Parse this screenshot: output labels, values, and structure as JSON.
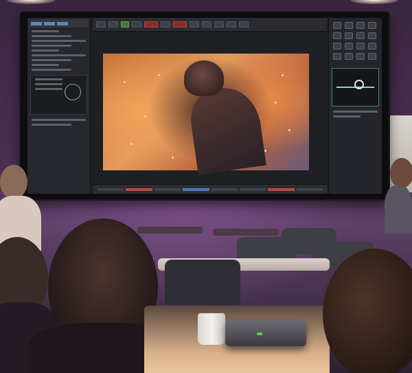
{
  "scene": {
    "description_colors": {
      "wall": "#4a2f52",
      "screen_bezel": "#0d0d10",
      "viewer_fire": "#e39b5d",
      "accent_red": "#b84a3c",
      "accent_blue": "#4a7ab8",
      "projector_led": "#4ed05a"
    }
  },
  "software": {
    "icons": {
      "scope": "oscilloscope-icon",
      "circle": "target-circle-icon"
    }
  }
}
